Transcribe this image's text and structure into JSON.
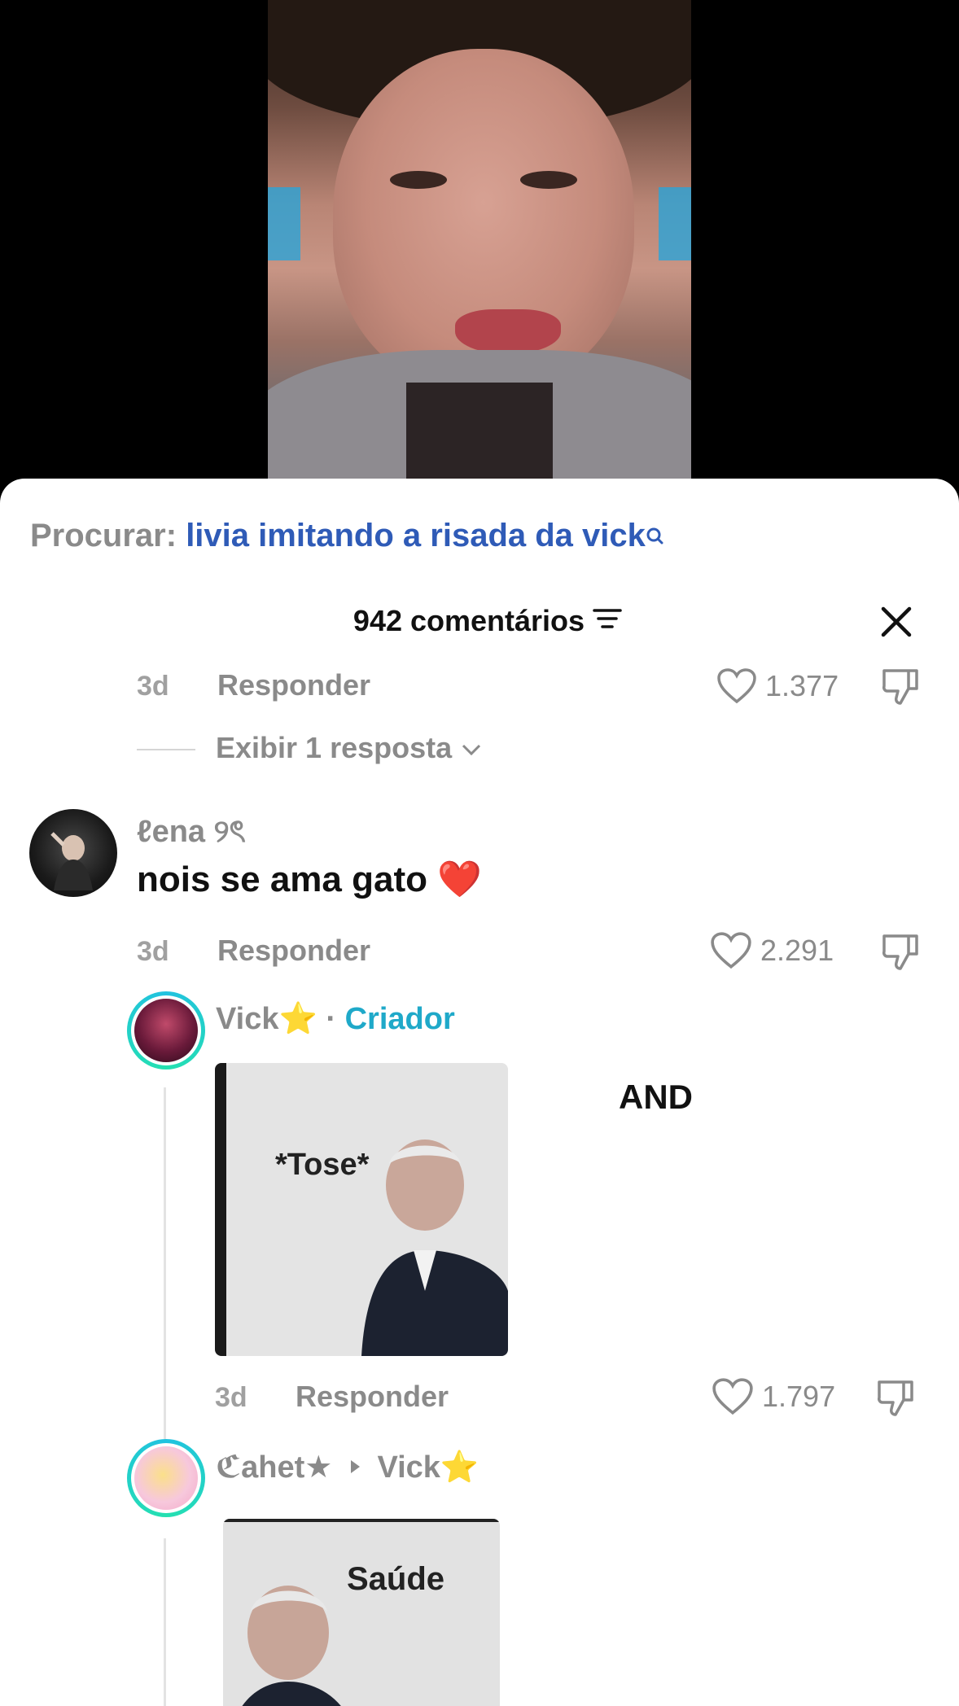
{
  "search": {
    "label": "Procurar:",
    "term": "livia imitando a risada da vick"
  },
  "header": {
    "comment_count": "942 comentários"
  },
  "prev_comment": {
    "time": "3d",
    "reply_label": "Responder",
    "likes": "1.377",
    "view_replies": "Exibir 1 resposta"
  },
  "comments": [
    {
      "username": "ℓena ୨ৎ",
      "text": "nois se ama gato ❤️",
      "time": "3d",
      "reply_label": "Responder",
      "likes": "2.291"
    }
  ],
  "replies": [
    {
      "username": "Vick⭐",
      "separator": "·",
      "badge": "Criador",
      "side_text": "AND",
      "sticker_caption": "*Tose*",
      "time": "3d",
      "reply_label": "Responder",
      "likes": "1.797"
    },
    {
      "username": "ℭahet★",
      "reply_to": "Vick⭐",
      "sticker_caption": "Saúde"
    }
  ],
  "colors": {
    "search_term": "#2f5bb7",
    "creator_badge": "#1fa9c9",
    "avatar_ring": "#21c2e0"
  }
}
